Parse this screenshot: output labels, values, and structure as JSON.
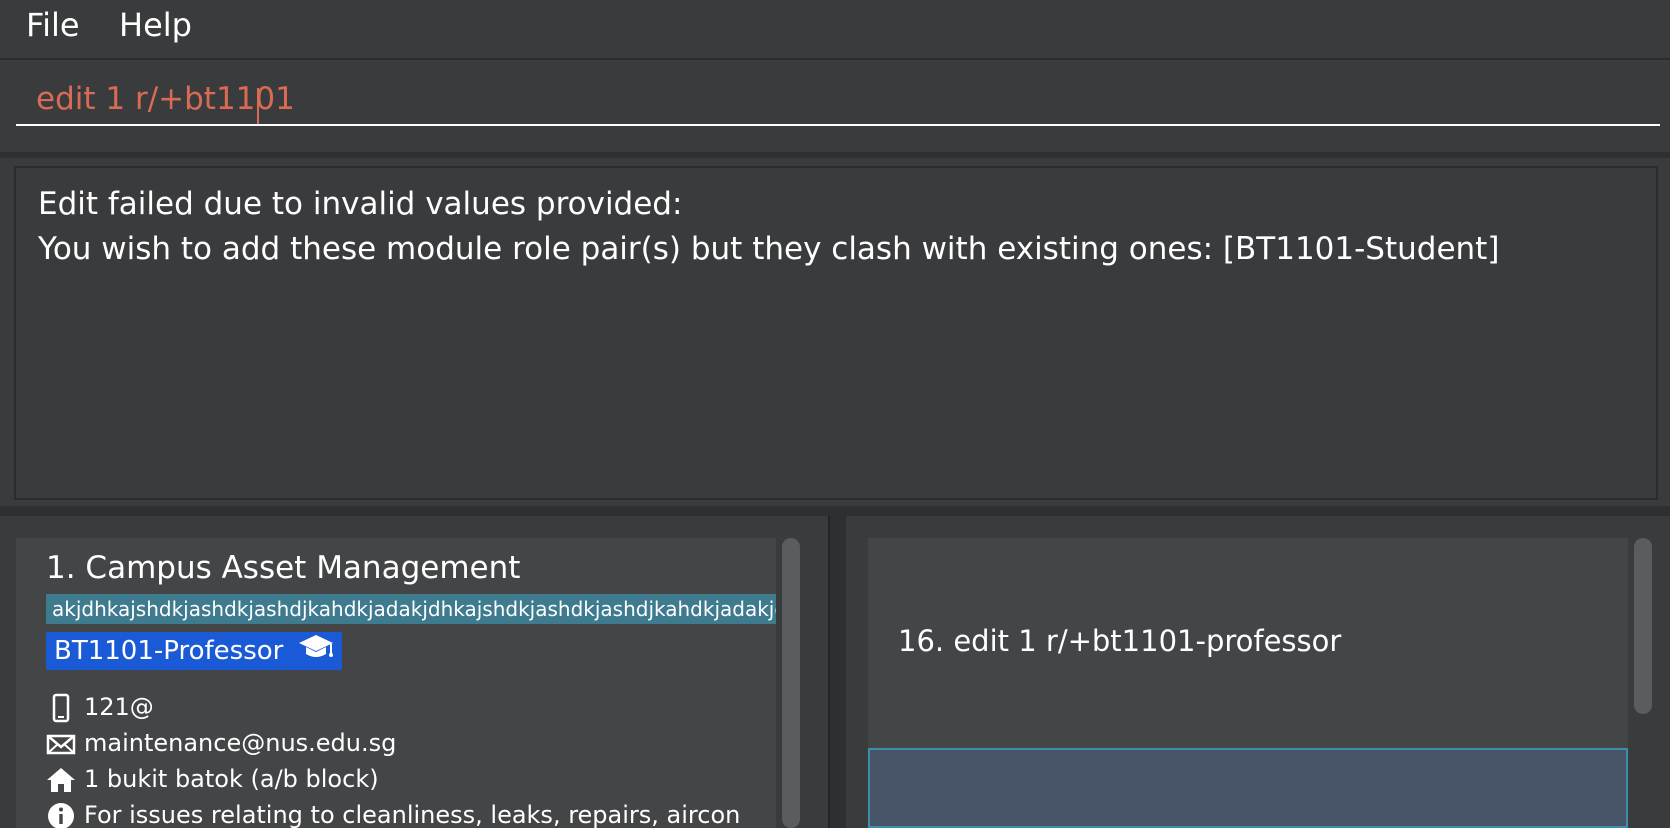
{
  "menu": {
    "file_label": "File",
    "help_label": "Help"
  },
  "command_box": {
    "value": "edit 1 r/+bt1101",
    "text_color": "#d96b55"
  },
  "result_display": {
    "line1": "Edit failed due to invalid values provided:",
    "line2": "You wish to add these module role pair(s) but they clash with existing ones: [BT1101-Student]"
  },
  "person_list": {
    "cards": [
      {
        "name": "1. Campus Asset Management",
        "description_tag": "akjdhkajshdkjashdkjashdjkahdkjadakjdhkajshdkjashdkjashdjkahdkjadakjdhkajshdkjashdkjashdjkahdkjadakjdhkajs",
        "role_tag": "BT1101-Professor",
        "role_icon": "graduation-cap-icon",
        "phone": "121@",
        "email": "maintenance@nus.edu.sg",
        "address": "1 bukit batok (a/b block)",
        "info": "For issues relating to cleanliness, leaks, repairs, aircon etc."
      }
    ]
  },
  "command_history": {
    "items": [
      {
        "text": "16. edit 1 r/+bt1101-professor"
      }
    ]
  },
  "colors": {
    "background": "#3a3b3d",
    "card": "#434547",
    "long_tag": "#3e7b8e",
    "role_tag": "#1a5ad6",
    "selected_card": "#485467",
    "selected_border": "#3c8fa8"
  }
}
